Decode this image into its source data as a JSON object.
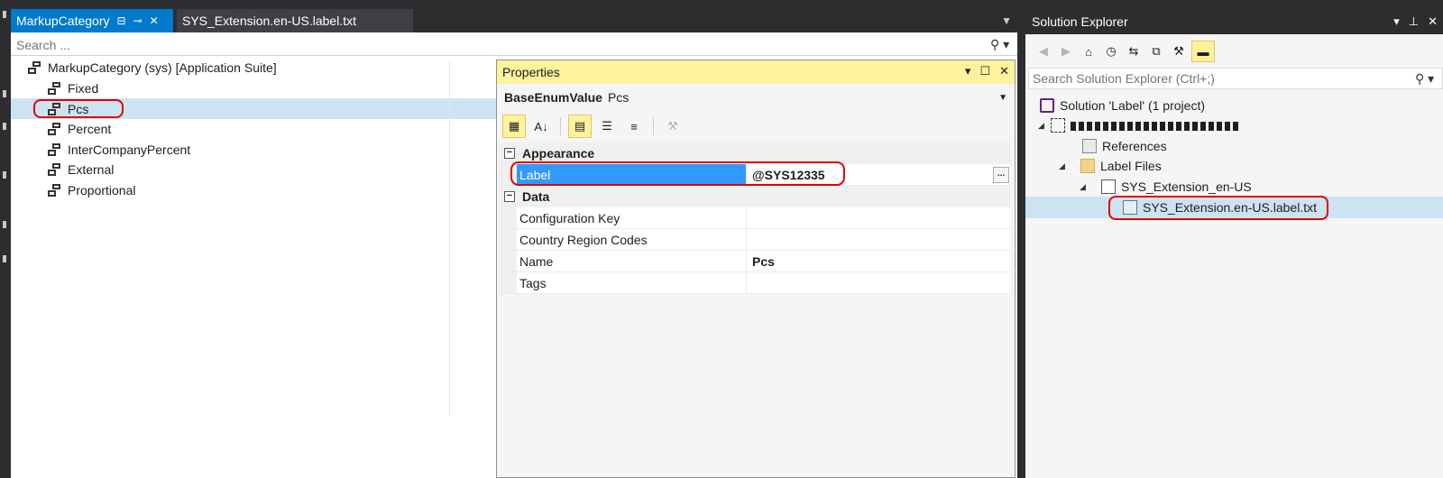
{
  "tabs": {
    "active": {
      "label": "MarkupCategory",
      "pin_glyph": "⊟",
      "autohide_glyph": "⊸",
      "close_glyph": "✕"
    },
    "second": {
      "label": "SYS_Extension.en-US.label.txt"
    }
  },
  "editor": {
    "search_placeholder": "Search ...",
    "root": "MarkupCategory (sys) [Application Suite]",
    "items": [
      "Fixed",
      "Pcs",
      "Percent",
      "InterCompanyPercent",
      "External",
      "Proportional"
    ]
  },
  "properties": {
    "title": "Properties",
    "object_type": "BaseEnumValue",
    "object_name": "Pcs",
    "categories": [
      {
        "name": "Appearance",
        "toggle": "⊟",
        "rows": [
          {
            "name": "Label",
            "value": "@SYS12335"
          }
        ]
      },
      {
        "name": "Data",
        "toggle": "⊟",
        "rows": [
          {
            "name": "Configuration Key",
            "value": ""
          },
          {
            "name": "Country Region Codes",
            "value": ""
          },
          {
            "name": "Name",
            "value": "Pcs"
          },
          {
            "name": "Tags",
            "value": ""
          }
        ]
      }
    ],
    "ellipsis": "..."
  },
  "solution_explorer": {
    "title": "Solution Explorer",
    "search_placeholder": "Search Solution Explorer (Ctrl+;)",
    "solution": "Solution 'Label' (1 project)",
    "references": "References",
    "label_files": "Label Files",
    "label_group": "SYS_Extension_en-US",
    "label_file": "SYS_Extension.en-US.label.txt"
  },
  "colors": {
    "accent": "#007acc",
    "selection": "#cce3f2",
    "highlight_ring": "#e20000",
    "tool_title": "#fff29d"
  }
}
